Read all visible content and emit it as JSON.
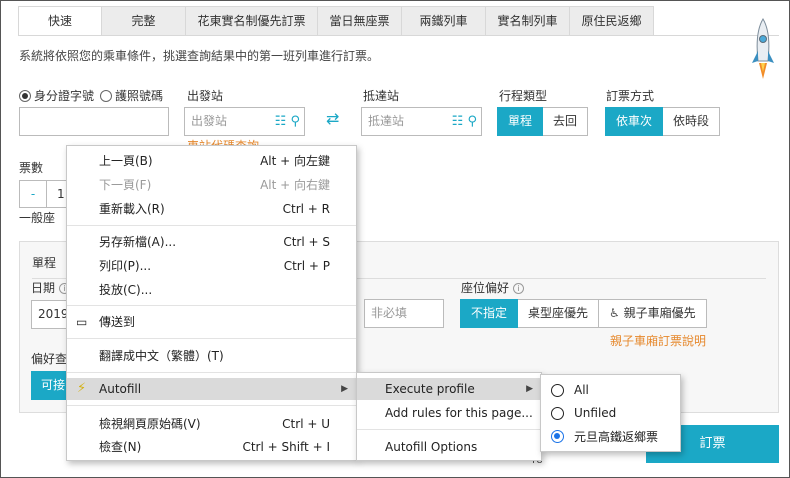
{
  "tabs": [
    "快速",
    "完整",
    "花東實名制優先訂票",
    "當日無座票",
    "兩鐵列車",
    "實名制列車",
    "原住民返鄉"
  ],
  "description": "系統將依照您的乘車條件，挑選查詢結果中的第一班列車進行訂票。",
  "id_type": {
    "option1": "身分證字號",
    "option2": "護照號碼"
  },
  "departure": {
    "label": "出發站",
    "placeholder": "出發站",
    "link": "車站代碼查詢"
  },
  "arrival": {
    "label": "抵達站",
    "placeholder": "抵達站"
  },
  "trip_type": {
    "label": "行程類型",
    "options": [
      "單程",
      "去回"
    ]
  },
  "order_method": {
    "label": "訂票方式",
    "options": [
      "依車次",
      "依時段"
    ]
  },
  "ticket_count": {
    "label": "票數",
    "minus": "-",
    "value": "1",
    "seat_label": "一般座"
  },
  "panel": {
    "heading": "單程",
    "date_label": "日期",
    "date_value": "2019",
    "optional_placeholder": "非必填",
    "seat_pref_label": "座位偏好",
    "seat_options": [
      "不指定",
      "桌型座優先",
      "親子車廂優先"
    ],
    "family_link": "親子車廂訂票說明",
    "pref_label": "偏好查",
    "avail_btn": "可接",
    "submit": "訂票",
    "bottom_frag": "ro"
  },
  "context_menu": {
    "items": [
      {
        "label": "上一頁(B)",
        "key": "Alt + 向左鍵"
      },
      {
        "label": "下一頁(F)",
        "key": "Alt + 向右鍵"
      },
      {
        "label": "重新載入(R)",
        "key": "Ctrl + R"
      },
      {
        "label": "另存新檔(A)...",
        "key": "Ctrl + S"
      },
      {
        "label": "列印(P)...",
        "key": "Ctrl + P"
      },
      {
        "label": "投放(C)...",
        "key": ""
      },
      {
        "label": "傳送到",
        "key": ""
      },
      {
        "label": "翻譯成中文（繁體）(T)",
        "key": ""
      },
      {
        "label": "Autofill",
        "key": ""
      },
      {
        "label": "檢視網頁原始碼(V)",
        "key": "Ctrl + U"
      },
      {
        "label": "檢查(N)",
        "key": "Ctrl + Shift + I"
      }
    ]
  },
  "autofill_submenu": {
    "items": [
      "Execute profile",
      "Add rules for this page...",
      "Autofill Options"
    ]
  },
  "profile_submenu": {
    "items": [
      "All",
      "Unfiled",
      "元旦高鐵返鄉票"
    ]
  }
}
